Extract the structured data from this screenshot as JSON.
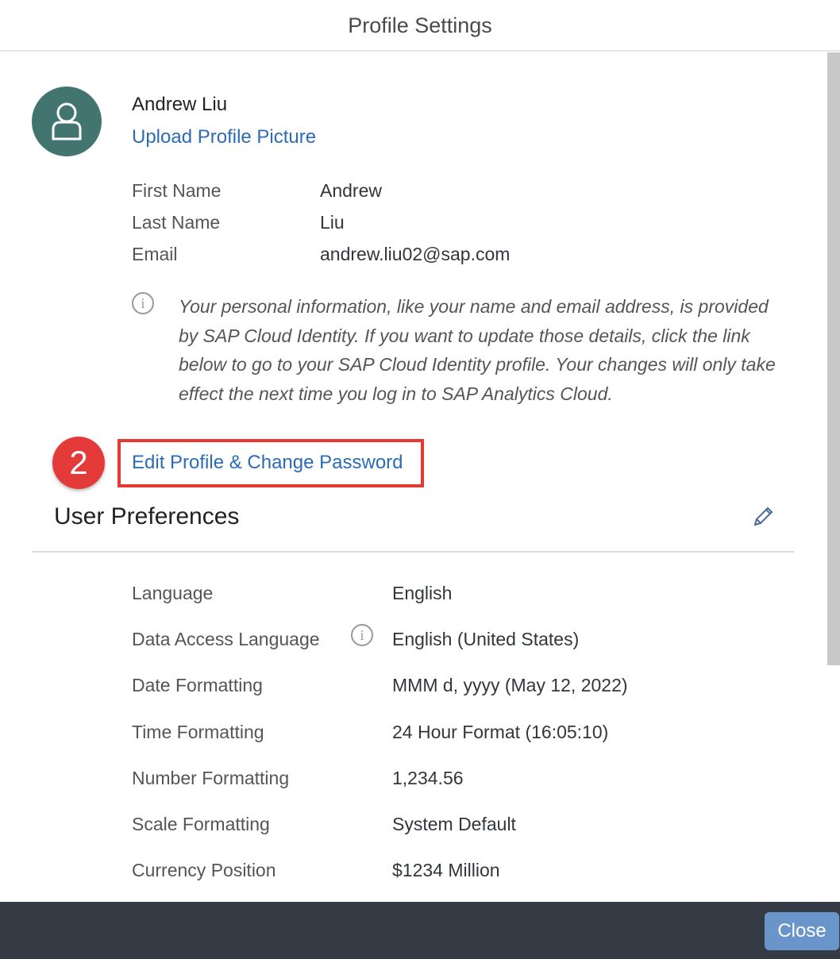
{
  "header": {
    "title": "Profile Settings"
  },
  "profile": {
    "name": "Andrew Liu",
    "upload_label": "Upload Profile Picture",
    "fields": [
      {
        "label": "First Name",
        "value": "Andrew"
      },
      {
        "label": "Last Name",
        "value": "Liu"
      },
      {
        "label": "Email",
        "value": "andrew.liu02@sap.com"
      }
    ],
    "info_icon": "i",
    "note": "Your personal information, like your name and email address, is provided by SAP Cloud Identity. If you want to update those details, click the link below to go to your SAP Cloud Identity profile. Your changes will only take effect the next time you log in to SAP Analytics Cloud.",
    "step_badge": "2",
    "edit_link": "Edit Profile & Change Password"
  },
  "preferences": {
    "title": "User Preferences",
    "items": [
      {
        "label": "Language",
        "value": "English"
      },
      {
        "label": "Data Access Language",
        "value": "English (United States)"
      },
      {
        "label": "Date Formatting",
        "value": "MMM d, yyyy (May 12, 2022)"
      },
      {
        "label": "Time Formatting",
        "value": "24 Hour Format (16:05:10)"
      },
      {
        "label": "Number Formatting",
        "value": "1,234.56"
      },
      {
        "label": "Scale Formatting",
        "value": "System Default"
      },
      {
        "label": "Currency Position",
        "value": "$1234 Million"
      }
    ]
  },
  "footer": {
    "close_label": "Close"
  },
  "colors": {
    "accent": "#2c6bb5",
    "avatar": "#437570",
    "badge": "#e43a3a",
    "footer": "#353b45",
    "close_button": "#6a95cb"
  }
}
